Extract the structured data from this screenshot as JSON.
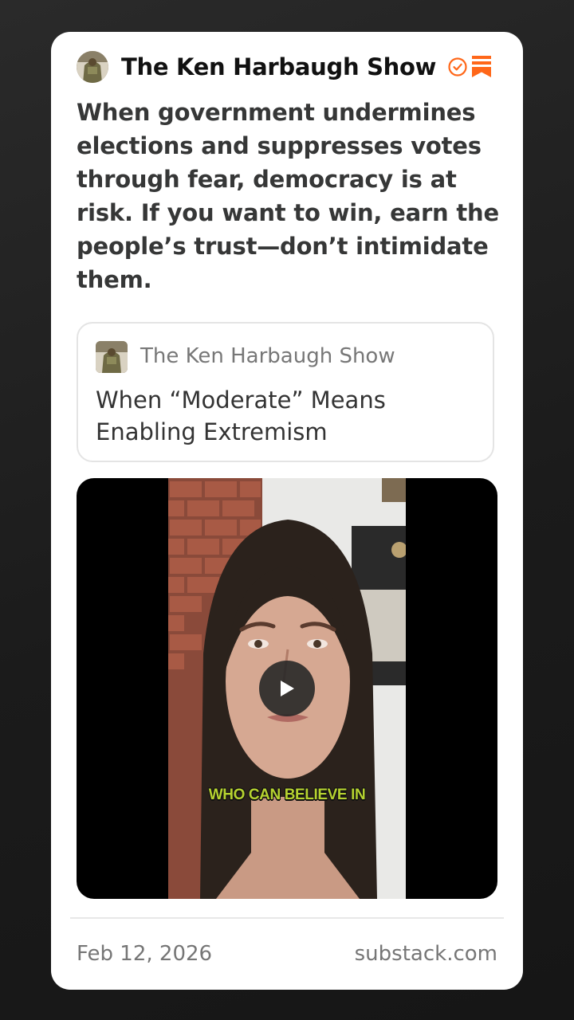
{
  "publication": {
    "name": "The Ken Harbaugh Show",
    "avatar_icon": "publication-avatar",
    "verified_icon": "verified-check-icon",
    "bookmark_icon": "bookmark-icon",
    "accent_color": "#ff6719"
  },
  "post": {
    "text": "When government undermines elections and suppresses votes through fear, democracy is at risk. If you want to win, earn the people’s trust—don’t intimidate them."
  },
  "linked_post": {
    "publication": "The Ken Harbaugh Show",
    "title": "When “Moderate” Means Enabling Extremism"
  },
  "video": {
    "caption": "WHO CAN BELIEVE IN",
    "play_icon": "play-icon"
  },
  "footer": {
    "date": "Feb 12, 2026",
    "domain": "substack.com"
  }
}
